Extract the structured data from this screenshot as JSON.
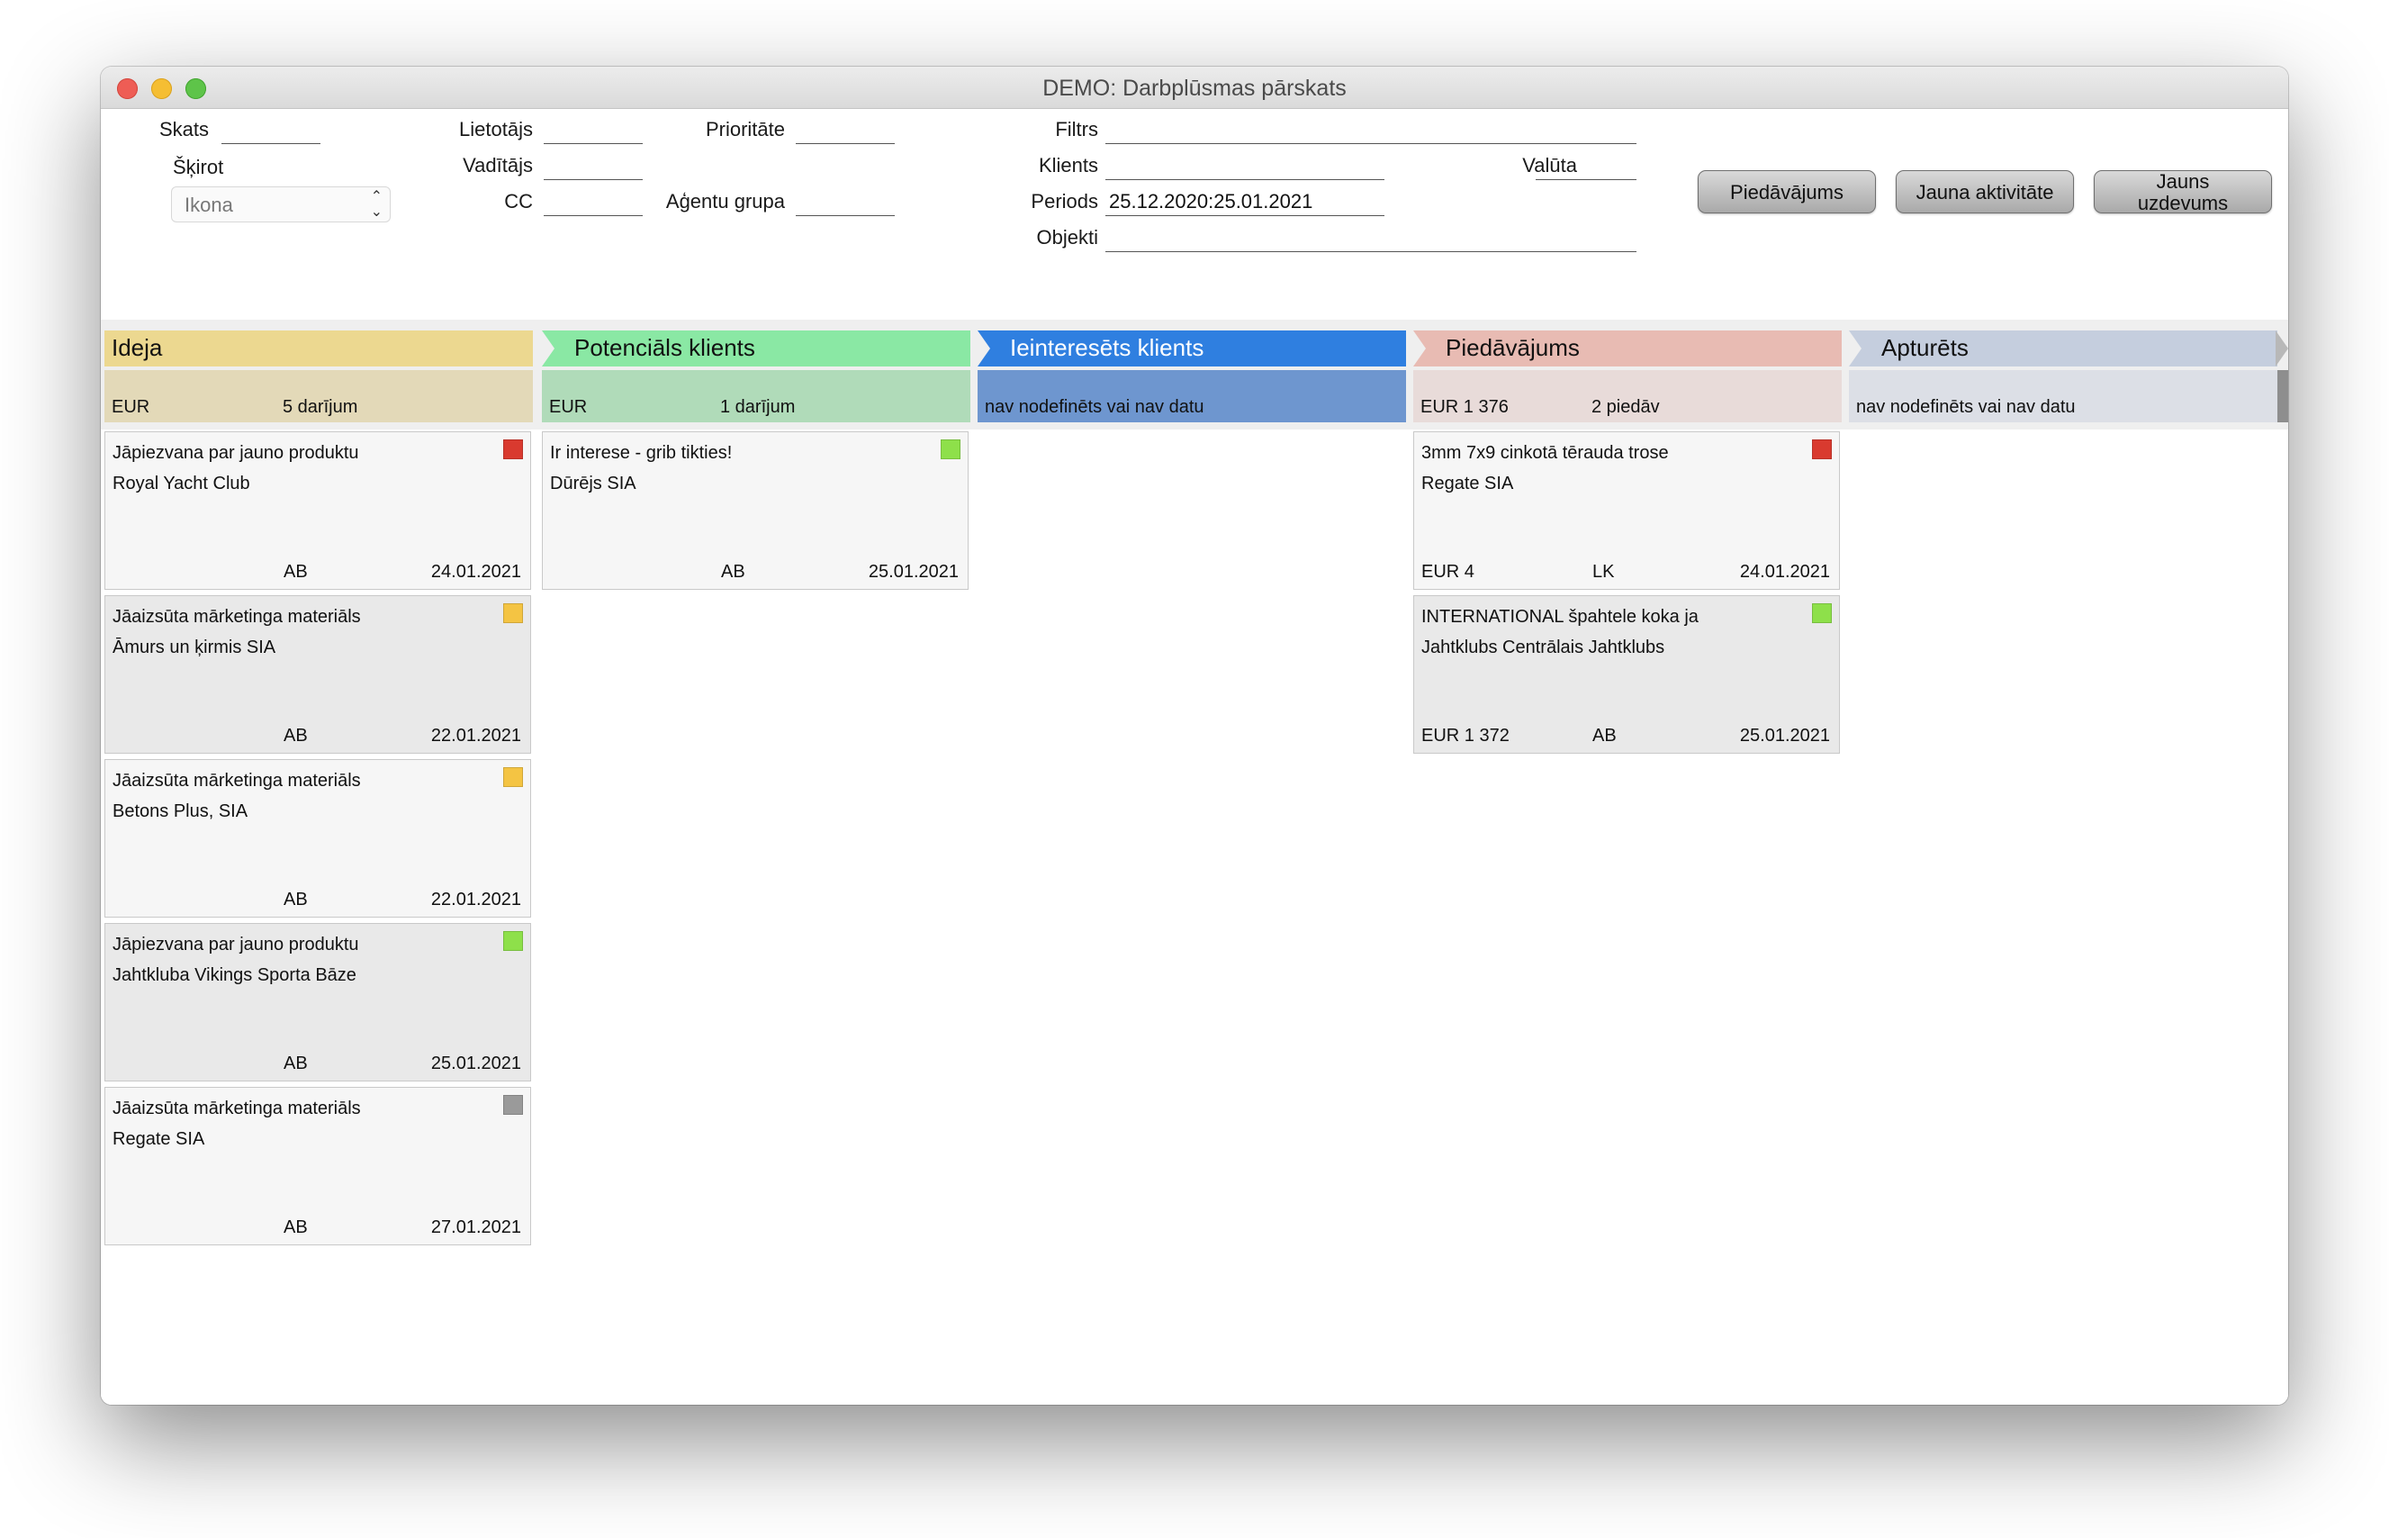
{
  "window": {
    "title": "DEMO: Darbplūsmas pārskats"
  },
  "filters": {
    "skats_label": "Skats",
    "skirot_label": "Šķirot",
    "skirot_value": "Ikona",
    "lietotajs_label": "Lietotājs",
    "vaditajs_label": "Vadītājs",
    "cc_label": "CC",
    "prioritate_label": "Prioritāte",
    "agentu_grupa_label": "Aģentu grupa",
    "filtrs_label": "Filtrs",
    "klienti_label": "Klients",
    "periods_label": "Periods",
    "periods_value": "25.12.2020:25.01.2021",
    "objekti_label": "Objekti",
    "valuta_label": "Valūta"
  },
  "buttons": {
    "piedavajums": "Piedāvājums",
    "jauna_aktivitate": "Jauna aktivitāte",
    "jauns_uzdevums_1": "Jauns",
    "jauns_uzdevums_2": "uzdevums"
  },
  "columns": [
    {
      "name": "Ideja",
      "color": "#ecd890",
      "sum_color": "#e3d9b8",
      "currency": "EUR",
      "count": "5 darījum",
      "nodata": ""
    },
    {
      "name": "Potenciāls klients",
      "color": "#8ae8a4",
      "sum_color": "#b0dbb9",
      "currency": "EUR",
      "count": "1 darījum",
      "nodata": ""
    },
    {
      "name": "Ieinteresēts klients",
      "color": "#2f7fe0",
      "sum_color": "#6e96cf",
      "currency": "",
      "count": "",
      "nodata": "nav nodefinēts vai nav datu"
    },
    {
      "name": "Piedāvājums",
      "color": "#e8bbb3",
      "sum_color": "#e8dbd9",
      "currency": "EUR 1 376",
      "count": "2 piedāv",
      "nodata": ""
    },
    {
      "name": "Apturēts",
      "color": "#c5cede",
      "sum_color": "#dcdfe6",
      "currency": "",
      "count": "",
      "nodata": "nav nodefinēts vai nav datu"
    }
  ],
  "cards": {
    "ideja": [
      {
        "line1": "Jāpiezvana par jauno produktu",
        "line2": "Royal Yacht Club",
        "amount": "",
        "agent": "AB",
        "date": "24.01.2021",
        "priority_color": "#d93a2f"
      },
      {
        "line1": "Jāaizsūta mārketinga materiāls",
        "line2": "Āmurs un ķirmis SIA",
        "amount": "",
        "agent": "AB",
        "date": "22.01.2021",
        "priority_color": "#f4c443"
      },
      {
        "line1": "Jāaizsūta mārketinga materiāls",
        "line2": "Betons Plus, SIA",
        "amount": "",
        "agent": "AB",
        "date": "22.01.2021",
        "priority_color": "#f4c443"
      },
      {
        "line1": "Jāpiezvana par jauno produktu",
        "line2": "Jahtkluba Vikings Sporta Bāze",
        "amount": "",
        "agent": "AB",
        "date": "25.01.2021",
        "priority_color": "#8ee04a"
      },
      {
        "line1": "Jāaizsūta mārketinga materiāls",
        "line2": "Regate SIA",
        "amount": "",
        "agent": "AB",
        "date": "27.01.2021",
        "priority_color": "#9a9a9a"
      }
    ],
    "potencials": [
      {
        "line1": "Ir interese - grib tikties!",
        "line2": "Dūrējs SIA",
        "amount": "",
        "agent": "AB",
        "date": "25.01.2021",
        "priority_color": "#8ee04a"
      }
    ],
    "piedavajums": [
      {
        "line1": "3mm 7x9 cinkotā tērauda trose",
        "line2": "Regate SIA",
        "amount": "EUR 4",
        "agent": "LK",
        "date": "24.01.2021",
        "priority_color": "#d93a2f"
      },
      {
        "line1": "INTERNATIONAL špahtele koka ja",
        "line2": "Jahtklubs Centrālais Jahtklubs",
        "amount": "EUR 1 372",
        "agent": "AB",
        "date": "25.01.2021",
        "priority_color": "#8ee04a"
      }
    ]
  }
}
